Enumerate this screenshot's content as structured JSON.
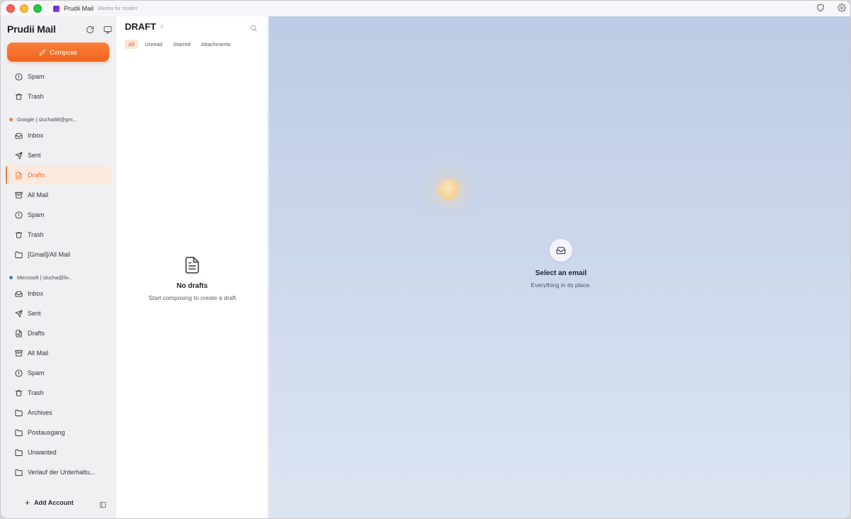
{
  "window": {
    "app_name": "Prudii Mail",
    "app_subtitle": "Mantra for studies"
  },
  "sidebar": {
    "title": "Prudii Mail",
    "compose_label": "Compose",
    "top_items": [
      {
        "label": "Spam",
        "icon": "alert-circle-icon"
      },
      {
        "label": "Trash",
        "icon": "trash-icon"
      }
    ],
    "accounts": [
      {
        "label": "Google | slucha88@gm...",
        "dot_color": "#f37a37",
        "items": [
          {
            "label": "Inbox",
            "icon": "inbox-icon"
          },
          {
            "label": "Sent",
            "icon": "send-icon"
          },
          {
            "label": "Drafts",
            "icon": "file-text-icon",
            "active": true
          },
          {
            "label": "All Mail",
            "icon": "archive-icon"
          },
          {
            "label": "Spam",
            "icon": "alert-circle-icon"
          },
          {
            "label": "Trash",
            "icon": "trash-icon"
          },
          {
            "label": "[Gmail]/All Mail",
            "icon": "folder-icon"
          }
        ]
      },
      {
        "label": "Microsoft | slucha@liv...",
        "dot_color": "#3d7fd6",
        "items": [
          {
            "label": "Inbox",
            "icon": "inbox-icon"
          },
          {
            "label": "Sent",
            "icon": "send-icon"
          },
          {
            "label": "Drafts",
            "icon": "file-text-icon"
          },
          {
            "label": "All Mail",
            "icon": "archive-icon"
          },
          {
            "label": "Spam",
            "icon": "alert-circle-icon"
          },
          {
            "label": "Trash",
            "icon": "trash-icon"
          },
          {
            "label": "Archives",
            "icon": "folder-icon"
          },
          {
            "label": "Postausgang",
            "icon": "folder-icon"
          },
          {
            "label": "Unwanted",
            "icon": "folder-icon"
          },
          {
            "label": "Verlauf der Unterhaltu...",
            "icon": "folder-icon"
          }
        ]
      }
    ],
    "add_account_label": "Add Account"
  },
  "list": {
    "title": "DRAFT",
    "count": "· 0",
    "filters": [
      "All",
      "Unread",
      "Starred",
      "Attachments"
    ],
    "active_filter": "All",
    "empty_title": "No drafts",
    "empty_subtitle": "Start composing to create a draft"
  },
  "reader": {
    "empty_title": "Select an email",
    "empty_subtitle": "Everything in its place."
  },
  "colors": {
    "accent": "#f37a37",
    "google_dot": "#f37a37",
    "microsoft_dot": "#3d7fd6"
  }
}
